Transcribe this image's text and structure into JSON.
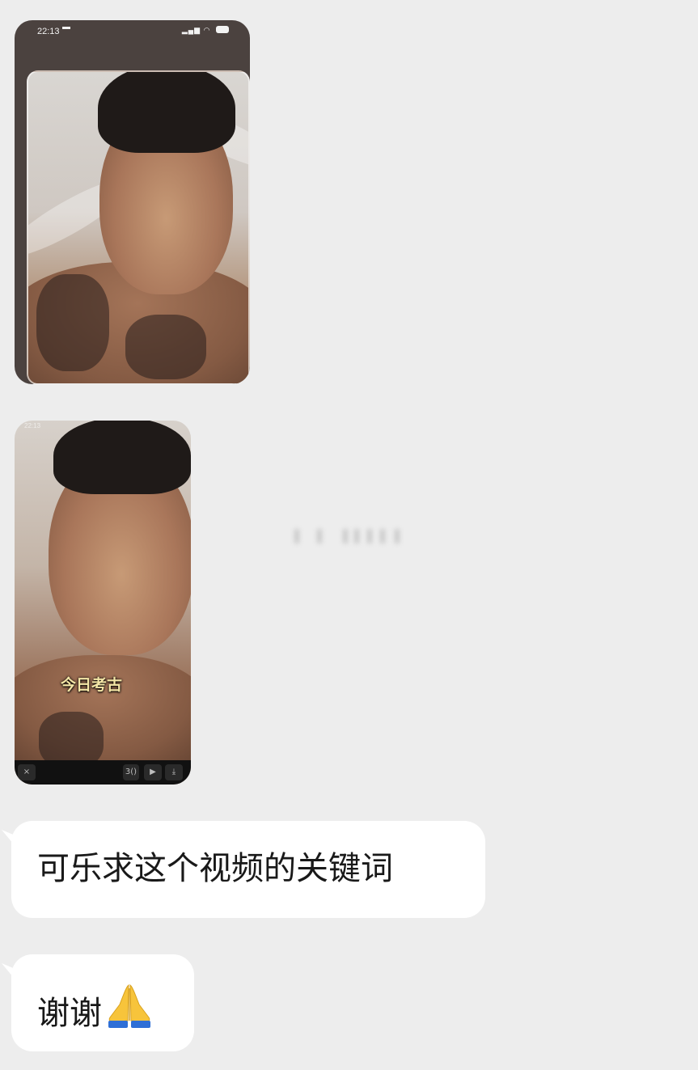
{
  "conversation": {
    "messages": [
      {
        "kind": "image",
        "status_bar": {
          "time": "22:13",
          "battery": "84"
        }
      },
      {
        "kind": "video",
        "caption": "今日考古",
        "toolbar": {
          "close": "×",
          "speed": "3()",
          "play": "▶",
          "download": "⤓"
        }
      },
      {
        "kind": "text",
        "text": "可乐求这个视频的关键词"
      },
      {
        "kind": "text",
        "text": "谢谢",
        "emoji": "folded-hands-icon"
      }
    ]
  },
  "colors": {
    "background": "#ededed",
    "bubble": "#ffffff",
    "text": "#191919",
    "caption": "#f4e6a6"
  }
}
